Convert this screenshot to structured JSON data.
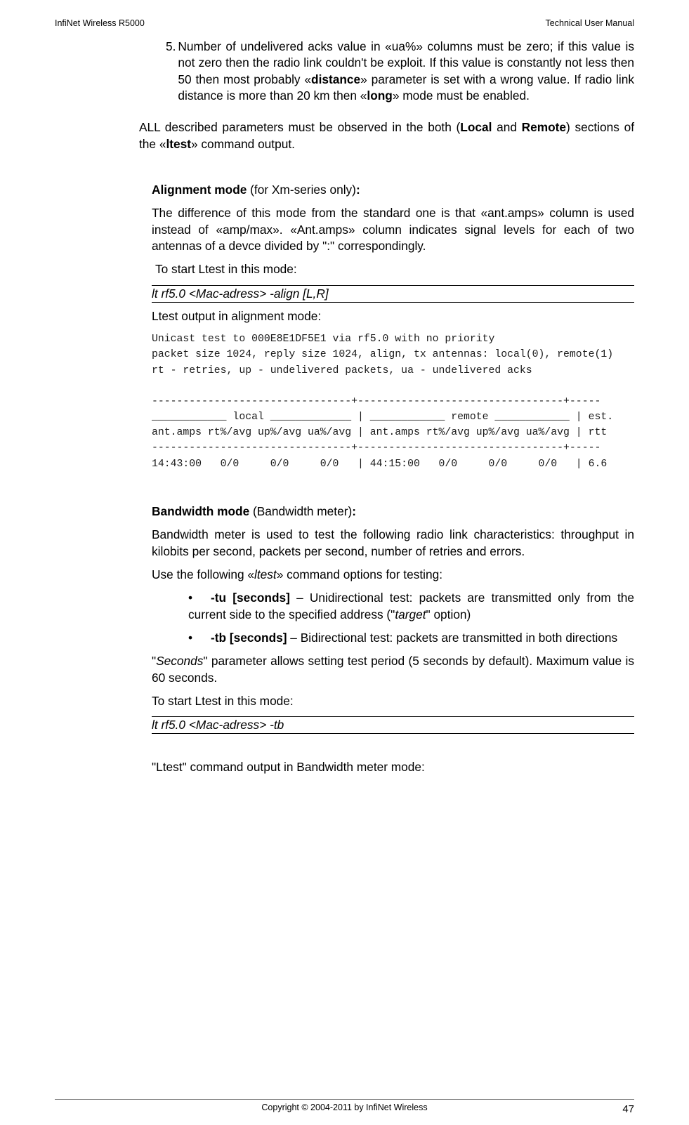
{
  "header": {
    "left": "InfiNet Wireless R5000",
    "right": "Technical User Manual"
  },
  "li5_num": "5.",
  "li5_p1": "Number of undelivered acks value in «ua%» columns must be zero; if this value is not zero then the radio link couldn't be exploit. If this value is constantly not less then 50 then most probably «",
  "li5_b1": "distance",
  "li5_p2": "» parameter is set with a wrong value. If radio link distance is more than 20 km then «",
  "li5_b2": "long",
  "li5_p3": "» mode must be enabled.",
  "all_p1": "ALL described parameters must be observed in the both (",
  "all_b1": "Local",
  "all_p2": " and ",
  "all_b2": "Remote",
  "all_p3": ") sections of the «",
  "all_b3": "ltest",
  "all_p4": "» command output.",
  "align_head_b": "Alignment mode",
  "align_head_t": " (for Xm-series only)",
  "align_colon": ":",
  "align_desc": "The difference of this mode from the standard one is that «ant.amps» column is used instead of «amp/max». «Ant.amps» column indicates signal levels for each of two antennas of a devce divided by \":\" correspondingly.",
  "align_start": " To start Ltest in this mode:",
  "align_cmd": "lt rf5.0 <Mac-adress> -align [L,R]",
  "align_out": "Ltest output in alignment mode:",
  "terminal": "Unicast test to 000E8E1DF5E1 via rf5.0 with no priority\npacket size 1024, reply size 1024, align, tx antennas: local(0), remote(1)\nrt - retries, up - undelivered packets, ua - undelivered acks\n\n--------------------------------+---------------------------------+-----\n____________ local _____________ | ____________ remote ____________ | est.\nant.amps rt%/avg up%/avg ua%/avg | ant.amps rt%/avg up%/avg ua%/avg | rtt\n--------------------------------+---------------------------------+-----\n14:43:00   0/0     0/0     0/0   | 44:15:00   0/0     0/0     0/0   | 6.6",
  "bw_head_b": "Bandwidth mode",
  "bw_head_t": " (Bandwidth meter)",
  "bw_colon": ":",
  "bw_desc": "Bandwidth meter is used to test the following radio link characteristics: throughput in kilobits per second, packets per second, number of retries and errors.",
  "bw_use_p1": "Use the following «",
  "bw_use_i": "ltest",
  "bw_use_p2": "» command options for testing:",
  "tu_b": "-tu [seconds]",
  "tu_p1": " – Unidirectional test: packets are transmitted only from the current side to the specified address (\"",
  "tu_i": "target",
  "tu_p2": "\" option)",
  "tb_b": "-tb [seconds]",
  "tb_p": " – Bidirectional test: packets are transmitted in both directions",
  "sec_p1": "\"",
  "sec_i": "Seconds",
  "sec_p2": "\" parameter allows setting test period (5 seconds by default). Maximum value is 60 seconds.",
  "bw_start": "To start Ltest in this mode:",
  "bw_cmd": "lt rf5.0 <Mac-adress> -tb",
  "bw_out": "\"Ltest\" command output in Bandwidth meter mode:",
  "footer": "Copyright © 2004-2011 by InfiNet Wireless",
  "page_num": "47"
}
